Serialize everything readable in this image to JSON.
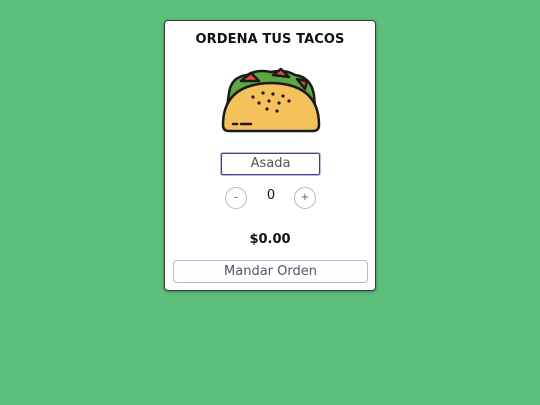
{
  "card": {
    "title": "ORDENA TUS TACOS",
    "image": "taco-illustration",
    "filling_select": {
      "value": "Asada"
    },
    "quantity": {
      "decrement_label": "–",
      "value": "0",
      "increment_label": "+"
    },
    "total": "$0.00",
    "submit_label": "Mandar Orden"
  },
  "colors": {
    "background": "#5cc07c",
    "card": "#ffffff",
    "accent_border": "#b7b2e4",
    "select_border": "#3f3f8f"
  }
}
